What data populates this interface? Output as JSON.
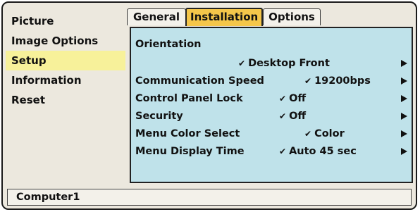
{
  "sidebar": {
    "items": [
      {
        "label": "Picture"
      },
      {
        "label": "Image Options"
      },
      {
        "label": "Setup",
        "selected": true
      },
      {
        "label": "Information"
      },
      {
        "label": "Reset"
      }
    ]
  },
  "tabs": [
    {
      "label": "General"
    },
    {
      "label": "Installation",
      "active": true
    },
    {
      "label": "Options"
    }
  ],
  "panel": {
    "orientation_label": "Orientation",
    "orientation_value": "Desktop Front",
    "rows": [
      {
        "label": "Communication Speed",
        "value": "19200bps"
      },
      {
        "label": "Control Panel Lock",
        "value": "Off"
      },
      {
        "label": "Security",
        "value": "Off"
      },
      {
        "label": "Menu Color Select",
        "value": "Color"
      },
      {
        "label": "Menu Display Time",
        "value": "Auto 45 sec"
      }
    ]
  },
  "status": {
    "source": "Computer1"
  },
  "colors": {
    "panel_bg": "#bfe2ea",
    "selected_tab": "#f4c64a",
    "selected_sidebar": "#f7f19a",
    "frame_bg": "#ece8de"
  }
}
